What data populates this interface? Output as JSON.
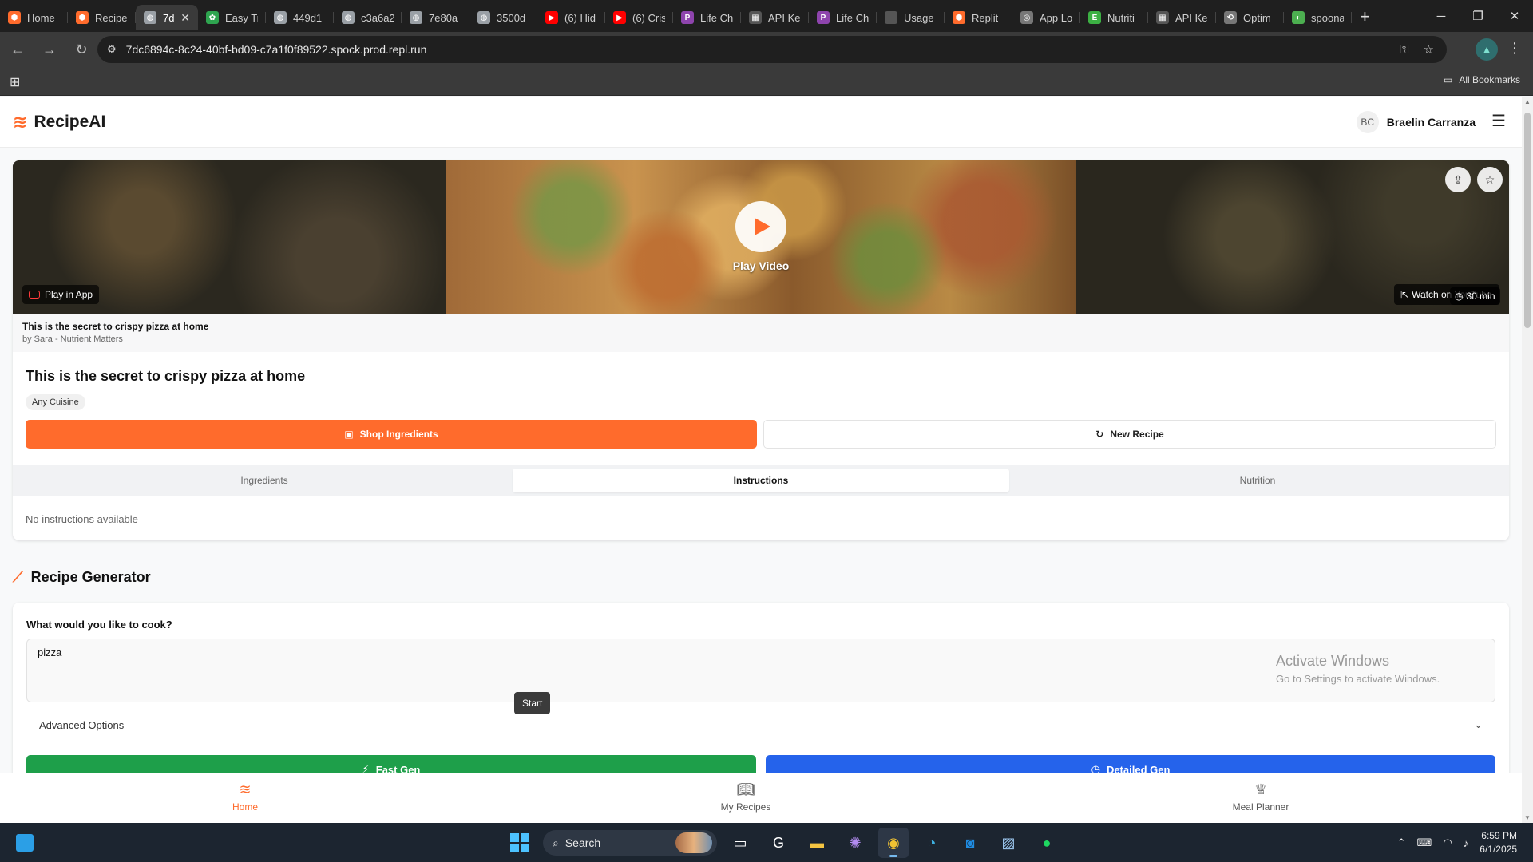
{
  "browser": {
    "tabs": [
      {
        "label": "Home",
        "color": "#ff6b2c",
        "icon": "replit-icon",
        "glyph": "⬢"
      },
      {
        "label": "Recipe",
        "color": "#ff6b2c",
        "icon": "replit-icon",
        "glyph": "⬢"
      },
      {
        "label": "7d",
        "color": "#9aa0a6",
        "icon": "globe-icon",
        "glyph": "◍",
        "active": true
      },
      {
        "label": "Easy Tr",
        "color": "#2ea44f",
        "icon": "recipe-site-icon",
        "glyph": "✿"
      },
      {
        "label": "449d1",
        "color": "#9aa0a6",
        "icon": "globe-icon",
        "glyph": "◍"
      },
      {
        "label": "c3a6a2",
        "color": "#9aa0a6",
        "icon": "globe-icon",
        "glyph": "◍"
      },
      {
        "label": "7e80a",
        "color": "#9aa0a6",
        "icon": "globe-icon",
        "glyph": "◍"
      },
      {
        "label": "3500d",
        "color": "#9aa0a6",
        "icon": "globe-icon",
        "glyph": "◍"
      },
      {
        "label": "(6) Hid",
        "color": "#ff0000",
        "icon": "youtube-icon",
        "glyph": "▶"
      },
      {
        "label": "(6) Cris",
        "color": "#ff0000",
        "icon": "youtube-icon",
        "glyph": "▶"
      },
      {
        "label": "Life Ch",
        "color": "#8e44ad",
        "icon": "p-icon",
        "glyph": "P"
      },
      {
        "label": "API Ke",
        "color": "#555555",
        "icon": "flag-icon",
        "glyph": "▦"
      },
      {
        "label": "Life Ch",
        "color": "#8e44ad",
        "icon": "p-icon",
        "glyph": "P"
      },
      {
        "label": "Usage",
        "color": "#555555",
        "icon": "blank-icon",
        "glyph": ""
      },
      {
        "label": "Replit",
        "color": "#ff6b2c",
        "icon": "replit-icon",
        "glyph": "⬢"
      },
      {
        "label": "App Lo",
        "color": "#777777",
        "icon": "openai-icon",
        "glyph": "◎"
      },
      {
        "label": "Nutriti",
        "color": "#3cb043",
        "icon": "nutrition-icon",
        "glyph": "E"
      },
      {
        "label": "API Ke",
        "color": "#555555",
        "icon": "flag-icon",
        "glyph": "▦"
      },
      {
        "label": "Optim",
        "color": "#777777",
        "icon": "link-icon",
        "glyph": "⟲"
      },
      {
        "label": "spoona",
        "color": "#4caf50",
        "icon": "spoonacular-icon",
        "glyph": "◐"
      }
    ],
    "url": "7dc6894c-8c24-40bf-bd09-c7a1f0f89522.spock.prod.repl.run",
    "all_bookmarks": "All Bookmarks"
  },
  "app": {
    "brand": "RecipeAI",
    "user_initials": "BC",
    "user_name": "Braelin Carranza"
  },
  "recipe": {
    "play_video": "Play Video",
    "play_in_app": "Play in App",
    "watch_on": "Watch on YouTube",
    "duration": "30 min",
    "video_title": "This is the secret to crispy pizza at home",
    "video_author": "by Sara - Nutrient Matters",
    "title": "This is the secret to crispy pizza at home",
    "cuisine": "Any Cuisine",
    "shop_label": "Shop Ingredients",
    "new_label": "New Recipe",
    "tabs": [
      {
        "label": "Ingredients"
      },
      {
        "label": "Instructions",
        "active": true
      },
      {
        "label": "Nutrition"
      }
    ],
    "empty_instructions": "No instructions available"
  },
  "generator": {
    "heading": "Recipe Generator",
    "question": "What would you like to cook?",
    "input_value": "pizza",
    "advanced": "Advanced Options",
    "fast_label": "Fast Gen",
    "detailed_label": "Detailed Gen"
  },
  "bottom_nav": {
    "home": "Home",
    "my_recipes": "My Recipes",
    "meal_planner": "Meal Planner",
    "tooltip": "Start"
  },
  "watermark": {
    "line1": "Activate Windows",
    "line2": "Go to Settings to activate Windows."
  },
  "taskbar": {
    "search": "Search",
    "time": "6:59 PM",
    "date": "6/1/2025"
  },
  "colors": {
    "accent": "#ff6b2c",
    "fast": "#1e9f4a",
    "detailed": "#2563eb"
  }
}
